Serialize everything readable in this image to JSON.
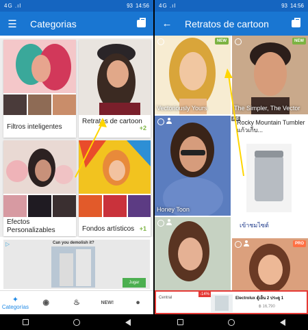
{
  "status": {
    "signal": "4G .ıl",
    "battery": "93",
    "time": "14:56"
  },
  "left": {
    "app_title": "Categorias",
    "cards": [
      {
        "label": "Filtros inteligentes",
        "count": ""
      },
      {
        "label": "Retratos de cartoon",
        "count": "+2"
      },
      {
        "label": "Efectos Personalizables",
        "count": ""
      },
      {
        "label": "Fondos artísticos",
        "count": "+1"
      }
    ],
    "ad": {
      "question": "Can you demolish it?",
      "button": "Jugar"
    },
    "nav": [
      {
        "label": "Categorías",
        "icon": "magic-wand-icon"
      },
      {
        "label": "",
        "icon": "ghost-icon"
      },
      {
        "label": "",
        "icon": "fire-icon"
      },
      {
        "label": "NEW!",
        "icon": ""
      },
      {
        "label": "",
        "icon": "person-icon"
      }
    ]
  },
  "right": {
    "app_title": "Retratos de cartoon",
    "tiles": [
      {
        "caption": "Vectoriously Yours",
        "badge": "NEW"
      },
      {
        "caption": "The Simpler, The Vector",
        "badge": "NEW"
      },
      {
        "caption": "Honey Toon",
        "badge": ""
      },
      {
        "caption": "",
        "badge": ""
      },
      {
        "caption": "",
        "badge": "PRO"
      }
    ],
    "ad": {
      "title": "Rocky Mountain Tumbler แก้วเก็บ...",
      "thai": "เข้าชมไซต์",
      "marker": "Ad"
    },
    "bottom_ad": {
      "logo": "Central",
      "discount": "-14%",
      "title": "Electrolux ตู้เย็น 2 ประตู 1",
      "price": "฿ 16,790"
    }
  },
  "colors": {
    "primary": "#1976d2",
    "accent": "#7cb342",
    "statusbar": "#1565c0"
  }
}
